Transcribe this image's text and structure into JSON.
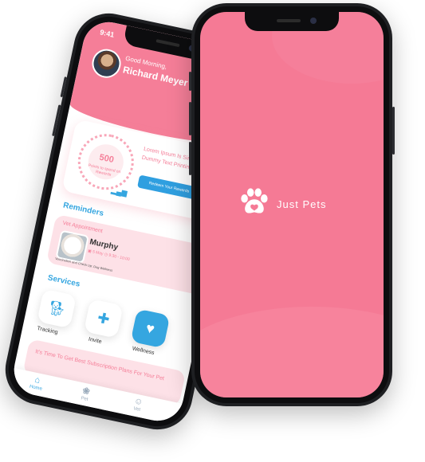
{
  "left_phone": {
    "status_time": "9:41",
    "status_icons": "▮▮ ◠ ▬",
    "greeting": "Good Morning,",
    "user_name": "Richard Meyer",
    "rewards": {
      "points": "500",
      "points_caption": "Points to spend on Rewards",
      "promo_text": "Lorem Ipsum Is Simply Dummy Text Printing",
      "redeem_label": "Redeem Your Rewards"
    },
    "reminders_title": "Reminders",
    "appointment": {
      "title": "Vet Appointment",
      "pet_name": "Murphy",
      "date": "5 May",
      "time": "9:30 - 10:00",
      "description": "Vaccination and Check Up: Dog Wellness"
    },
    "services_title": "Services",
    "services": [
      {
        "label": "Tracking",
        "icon": "dog-icon"
      },
      {
        "label": "Invite",
        "icon": "add-user-icon"
      },
      {
        "label": "Wellness",
        "icon": "heartbeat-icon"
      }
    ],
    "subscription_text": "It's Time To Get Best Subscription Plans For Your Pet",
    "nav": [
      {
        "label": "Home",
        "icon": "home-icon"
      },
      {
        "label": "Pet",
        "icon": "paw-icon"
      },
      {
        "label": "Vet",
        "icon": "person-icon"
      }
    ]
  },
  "right_phone": {
    "brand_name": "Just Pets",
    "background_color": "#f57a95"
  },
  "colors": {
    "brand_pink": "#f57e98",
    "accent_blue": "#35a6e0"
  }
}
